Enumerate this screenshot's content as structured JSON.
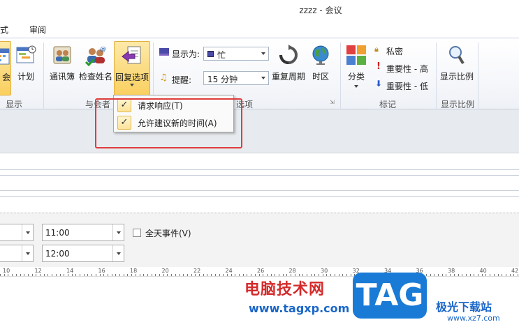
{
  "window": {
    "title": "zzzz  -  会议"
  },
  "tabs": [
    {
      "label": "式"
    },
    {
      "label": "审阅"
    }
  ],
  "ribbon": {
    "show_group": {
      "meeting_label": "会",
      "schedule_label": "计划",
      "group_label": "显示"
    },
    "attendees_group": {
      "address_book_label": "通讯簿",
      "check_names_label": "检查姓名",
      "response_options_label": "回复选项",
      "group_label": "与会者"
    },
    "options_group": {
      "show_as_label": "显示为:",
      "show_as_value": "忙",
      "reminder_label": "提醒:",
      "reminder_value": "15 分钟",
      "recurrence_label": "重复周期",
      "timezone_label": "时区",
      "group_label": "选项"
    },
    "tags_group": {
      "categorize_label": "分类",
      "private_label": "私密",
      "high_importance_label": "重要性 - 高",
      "low_importance_label": "重要性 - 低",
      "group_label": "标记"
    },
    "zoom_group": {
      "zoom_label": "显示比例",
      "group_label": "显示比例"
    }
  },
  "response_menu": {
    "items": [
      {
        "label": "请求响应(T)",
        "checked": true
      },
      {
        "label": "允许建议新的时间(A)",
        "checked": true
      }
    ],
    "check_glyph": "✓"
  },
  "time_fields": {
    "start_time": "11:00",
    "end_time": "12:00",
    "all_day_label": "全天事件(V)"
  },
  "ruler_labels": [
    "10",
    "12",
    "14",
    "16",
    "18",
    "20",
    "22",
    "24",
    "26",
    "28",
    "30",
    "32",
    "34",
    "36",
    "38",
    "40",
    "42"
  ],
  "watermark": {
    "site_cn": "电脑技术网",
    "site_url": "www.tagxp.com",
    "tag": "TAG",
    "brand_cn": "极光下载站",
    "brand_url": "www.xz7.com"
  },
  "colors": {
    "highlight_box": "#e03c3c",
    "active_button": "#f9cf5f",
    "busy_color": "#4a4aa8"
  }
}
